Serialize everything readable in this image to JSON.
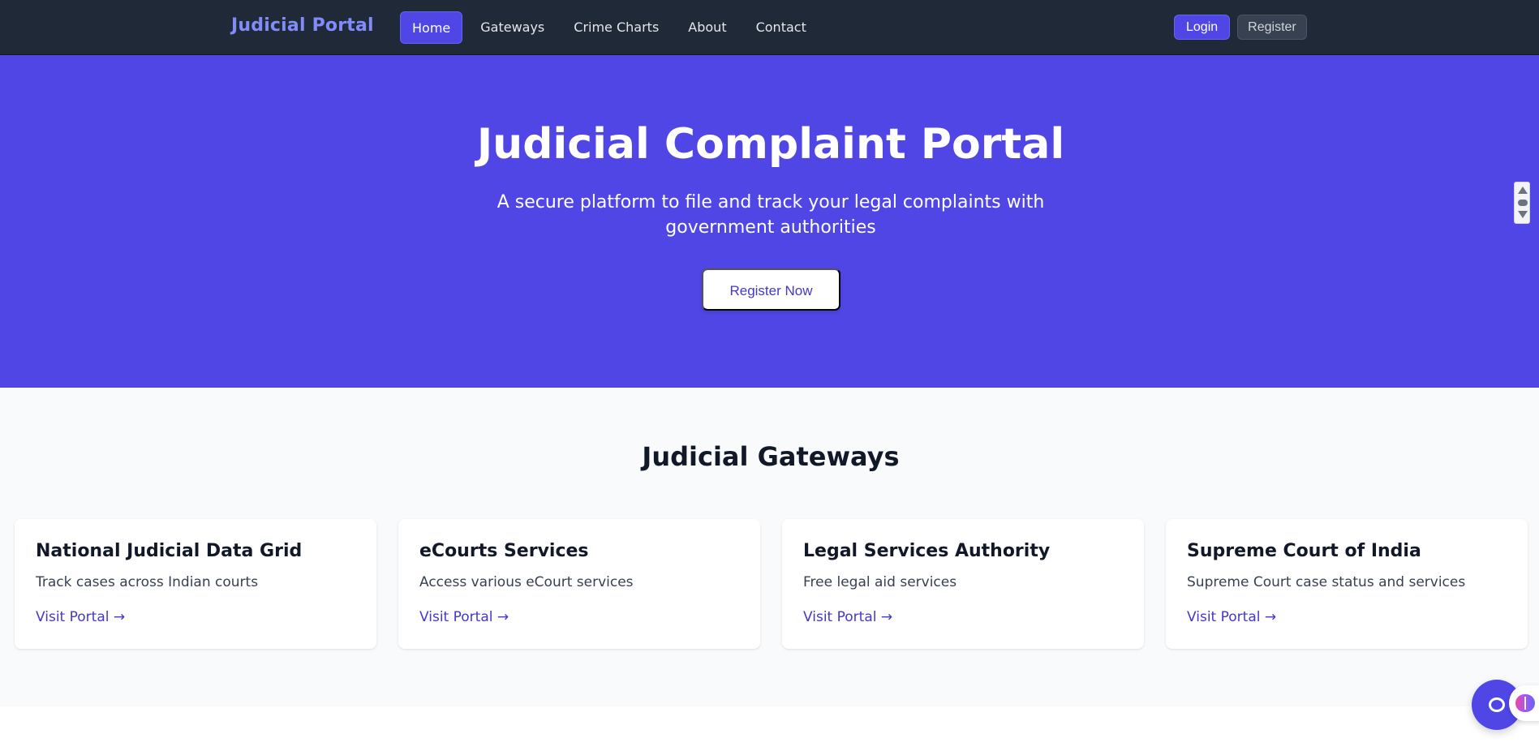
{
  "navbar": {
    "brand": "Judicial Portal",
    "links": [
      {
        "label": "Home",
        "active": true
      },
      {
        "label": "Gateways",
        "active": false
      },
      {
        "label": "Crime Charts",
        "active": false
      },
      {
        "label": "About",
        "active": false
      },
      {
        "label": "Contact",
        "active": false
      }
    ],
    "login_label": "Login",
    "register_label": "Register"
  },
  "hero": {
    "title": "Judicial Complaint Portal",
    "subtitle": "A secure platform to file and track your legal complaints with government authorities",
    "cta_label": "Register Now"
  },
  "gateways": {
    "title": "Judicial Gateways",
    "cards": [
      {
        "title": "National Judicial Data Grid",
        "description": "Track cases across Indian courts",
        "link_label": "Visit Portal →"
      },
      {
        "title": "eCourts Services",
        "description": "Access various eCourt services",
        "link_label": "Visit Portal →"
      },
      {
        "title": "Legal Services Authority",
        "description": "Free legal aid services",
        "link_label": "Visit Portal →"
      },
      {
        "title": "Supreme Court of India",
        "description": "Supreme Court case status and services",
        "link_label": "Visit Portal →"
      }
    ]
  },
  "widgets": {
    "chat_icon": "chat-bubble-icon",
    "extension_icon": "brain-icon",
    "scroll_icons": [
      "arrow-up-icon",
      "drag-handle-icon",
      "arrow-down-icon"
    ]
  },
  "colors": {
    "navbar_bg": "#1f2937",
    "brand": "#818cf8",
    "primary": "#4f46e5",
    "link": "#4338ca",
    "section_bg": "#f9fafb"
  }
}
